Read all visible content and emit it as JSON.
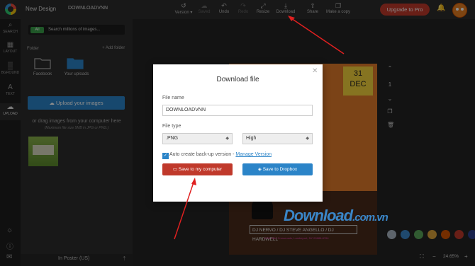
{
  "topbar": {
    "new_design_label": "New Design",
    "doc_name": "DOWNLOADVNN",
    "tools": [
      {
        "label": "Version",
        "icon": "history-icon"
      },
      {
        "label": "Saved",
        "icon": "save-icon"
      },
      {
        "label": "Undo",
        "icon": "undo-icon"
      },
      {
        "label": "Redo",
        "icon": "redo-icon"
      },
      {
        "label": "Resize",
        "icon": "resize-icon"
      },
      {
        "label": "Download",
        "icon": "download-icon"
      },
      {
        "label": "Share",
        "icon": "share-icon"
      },
      {
        "label": "Make a copy",
        "icon": "copy-icon"
      }
    ],
    "upgrade_label": "Upgrade to Pro",
    "brand_color": "#c0392b"
  },
  "leftnav": [
    {
      "label": "SEARCH",
      "icon": "search-icon"
    },
    {
      "label": "LAYOUT",
      "icon": "layout-icon"
    },
    {
      "label": "BGROUND",
      "icon": "background-icon"
    },
    {
      "label": "TEXT",
      "icon": "text-icon"
    },
    {
      "label": "UPLOAD",
      "icon": "upload-icon"
    }
  ],
  "panel": {
    "search_filter": "All",
    "search_placeholder": "Search millions of images...",
    "folder_header": "Folder",
    "add_folder": "+ Add folder",
    "folders": [
      "Facebook",
      "Your uploads"
    ],
    "upload_button": "Upload your images",
    "drag_text": "or drag images from your computer here",
    "drag_note": "(Maximum file size 5MB in JPG or PNG.)",
    "footer": "In Poster (US)"
  },
  "poster": {
    "date_day": "31",
    "date_month": "DEC",
    "dj_line": "DJ NERVO / DJ STEVE ANGELLO / DJ HARDWELL",
    "address": "1234 Little Crossroads, Lambeport, NY 09686-8764"
  },
  "canvas": {
    "page_number": "1",
    "zoom": "24.65%",
    "palette": [
      "#aab7c4",
      "#3a86c8",
      "#5aa65a",
      "#d9a13a",
      "#d35400",
      "#c0392b",
      "#2c3e8c"
    ]
  },
  "modal": {
    "title": "Download file",
    "file_name_label": "File name",
    "file_name_value": "DOWNLOADVNN",
    "file_type_label": "File type",
    "file_type_value": ".PNG",
    "quality_value": "High",
    "backup_label": "Auto create back-up version - ",
    "manage_version_link": "Manage Version",
    "save_computer": "Save to my computer",
    "save_dropbox": "Save to Dropbox"
  },
  "watermark": {
    "main": "Download",
    "sub": ".com.vn"
  }
}
